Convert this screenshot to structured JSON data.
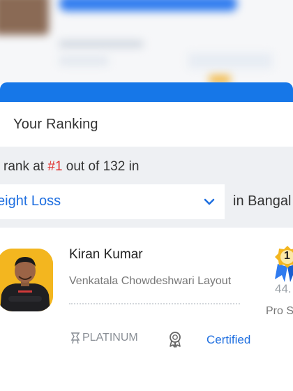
{
  "header": {
    "title": "Your Ranking"
  },
  "ranking": {
    "prefix": "rank at",
    "rank": "#1",
    "suffix": "out of 132 in",
    "category_selected": "eight Loss",
    "city_text": "in Bangal"
  },
  "trainer": {
    "name": "Kiran Kumar",
    "location": "Venkatala Chowdeshwari Layout",
    "score": "44.",
    "level_label": "Pro S",
    "badge_number": "1",
    "tier": "PLATINUM",
    "certified_label": "Certified"
  },
  "colors": {
    "accent": "#1f6fe0",
    "rank": "#e0322f",
    "avatar_bg": "#f3b61f",
    "badge": "#f3b61f"
  },
  "icons": [
    "chevron-down-icon",
    "tier-icon",
    "award-icon",
    "rank-badge-icon"
  ]
}
